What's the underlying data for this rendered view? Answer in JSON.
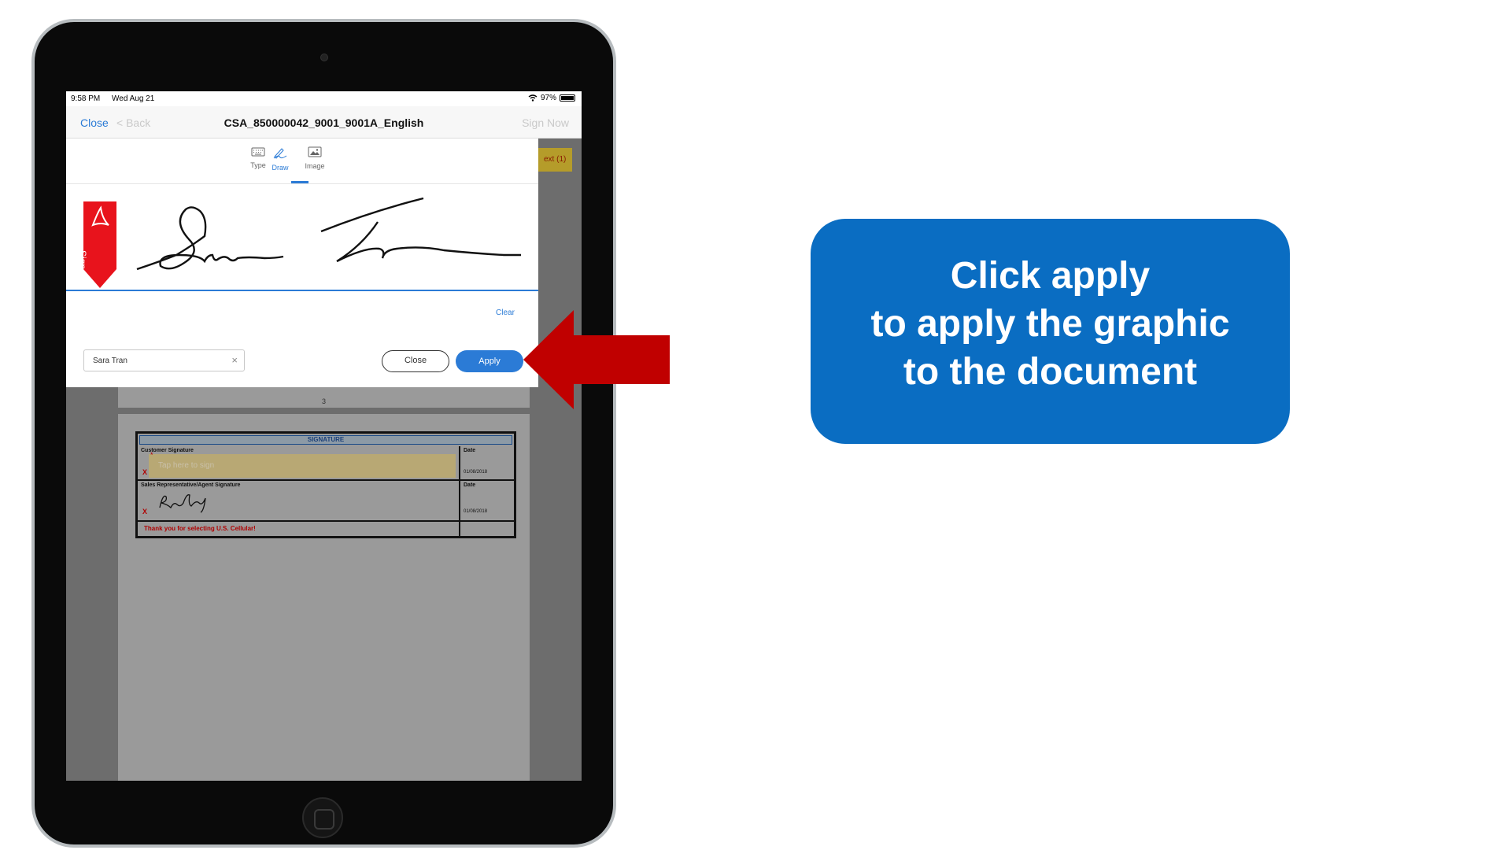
{
  "status_bar": {
    "time": "9:58 PM",
    "date": "Wed Aug 21",
    "battery": "97%",
    "battery_level": 0.97
  },
  "nav": {
    "close_label": "Close",
    "back_label": "< Back",
    "title": "CSA_850000042_9001_9001A_English",
    "sign_now_label": "Sign Now"
  },
  "document": {
    "page_number": "3",
    "next_tag": "ext (1)",
    "signature_table": {
      "header": "SIGNATURE",
      "customer_label": "Customer Signature",
      "tap_prompt": "Tap here to sign",
      "date_label": "Date",
      "date_value_1": "01/08/2018",
      "rep_label": "Sales Representative/Agent Signature",
      "date_value_2": "01/08/2018",
      "thanks": "Thank you for selecting U.S. Cellular!",
      "x_mark": "X",
      "star_mark": "*"
    }
  },
  "signature_panel": {
    "tabs": [
      {
        "label": "Type",
        "icon": "keyboard-icon"
      },
      {
        "label": "Draw",
        "icon": "pen-draw-icon",
        "selected": true
      },
      {
        "label": "Image",
        "icon": "image-icon"
      }
    ],
    "ribbon_label": "Sign",
    "clear_label": "Clear",
    "name_value": "Sara Tran",
    "close_label": "Close",
    "apply_label": "Apply"
  },
  "callout": {
    "line1": "Click apply",
    "line2": "to apply the graphic",
    "line3": "to the document",
    "color": "#0a6dc2"
  },
  "colors": {
    "accent": "#2b7bd6",
    "arrow": "#c00000"
  }
}
